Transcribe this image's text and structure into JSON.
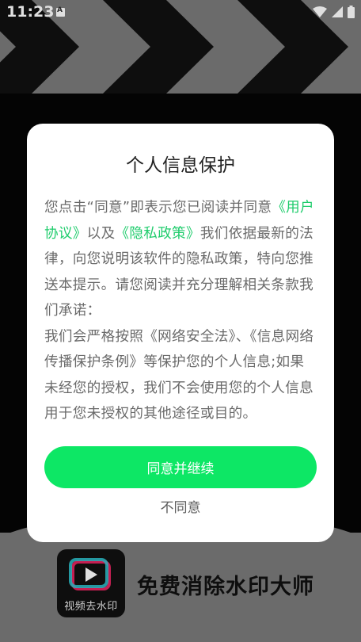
{
  "status_bar": {
    "time": "11:23",
    "notification_icon": "font-download-icon",
    "icons": [
      "wifi-icon",
      "signal-icon",
      "battery-icon"
    ]
  },
  "background_app": {
    "logo_caption": "视频去水印",
    "app_name": "免费消除水印大师"
  },
  "dialog": {
    "title": "个人信息保护",
    "body": {
      "p1_before": "您点击“同意”即表示您已阅读并同意",
      "link_user": "《用户协议》",
      "p1_mid": "以及",
      "link_privacy": "《隐私政策》",
      "p1_after": "我们依据最新的法律，向您说明该软件的隐私政策，特向您推送本提示。请您阅读并充分理解相关条款我们承诺：",
      "p2": "我们会严格按照《网络安全法》、《信息网络传播保护条例》等保护您的个人信息;如果未经您的授权，我们不会使用您的个人信息用于您未授权的其他途径或目的。"
    },
    "agree_label": "同意并继续",
    "disagree_label": "不同意"
  },
  "colors": {
    "accent": "#0de765",
    "link": "#1fcc6c",
    "dialog_bg": "#ffffff"
  }
}
